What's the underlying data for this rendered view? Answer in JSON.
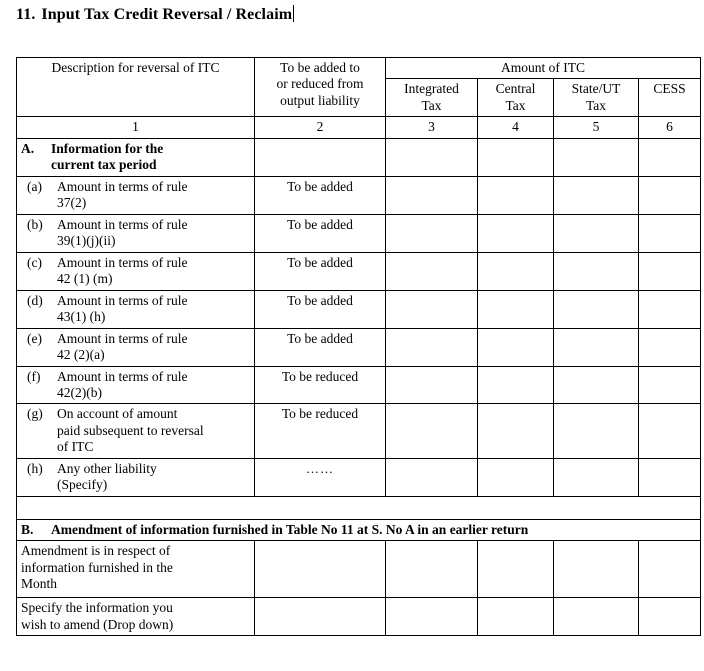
{
  "document": {
    "title_number": "11.",
    "title_text": "Input Tax Credit Reversal / Reclaim",
    "caret_visible": true
  },
  "table": {
    "headers": {
      "description": "Description for reversal of ITC",
      "liability_line1": "To be added to",
      "liability_line2": "or reduced from",
      "liability_line3": "output liability",
      "amount_group": "Amount of ITC",
      "integrated_line1": "Integrated",
      "integrated_line2": "Tax",
      "central_line1": "Central",
      "central_line2": "Tax",
      "state_line1": "State/UT",
      "state_line2": "Tax",
      "cess": "CESS"
    },
    "column_numbers": [
      "1",
      "2",
      "3",
      "4",
      "5",
      "6"
    ],
    "section_a": {
      "label": "A.",
      "title_line1": "Information for the",
      "title_line2": "current tax period",
      "rows": [
        {
          "mark": "(a)",
          "desc_line1": "Amount in terms of rule",
          "desc_line2": "37(2)",
          "liability": "To be added",
          "integrated": "",
          "central": "",
          "state": "",
          "cess": ""
        },
        {
          "mark": "(b)",
          "desc_line1": "Amount in terms of rule",
          "desc_line2": "39(1)(j)(ii)",
          "liability": "To be added",
          "integrated": "",
          "central": "",
          "state": "",
          "cess": ""
        },
        {
          "mark": "(c)",
          "desc_line1": "Amount in terms of rule",
          "desc_line2": "42 (1) (m)",
          "liability": "To be added",
          "integrated": "",
          "central": "",
          "state": "",
          "cess": ""
        },
        {
          "mark": "(d)",
          "desc_line1": "Amount in terms of rule",
          "desc_line2": "43(1) (h)",
          "liability": "To be added",
          "integrated": "",
          "central": "",
          "state": "",
          "cess": ""
        },
        {
          "mark": "(e)",
          "desc_line1": "Amount in terms of rule",
          "desc_line2": "42 (2)(a)",
          "liability": "To be added",
          "integrated": "",
          "central": "",
          "state": "",
          "cess": ""
        },
        {
          "mark": "(f)",
          "desc_line1": "Amount in terms of rule",
          "desc_line2": "42(2)(b)",
          "liability": "To be reduced",
          "integrated": "",
          "central": "",
          "state": "",
          "cess": ""
        },
        {
          "mark": "(g)",
          "desc_line1": "On account of amount",
          "desc_line2": "paid subsequent to reversal",
          "desc_line3": "of ITC",
          "liability": "To be reduced",
          "integrated": "",
          "central": "",
          "state": "",
          "cess": ""
        },
        {
          "mark": "(h)",
          "desc_line1": "Any other liability",
          "desc_line2": "(Specify)",
          "liability": "……",
          "integrated": "",
          "central": "",
          "state": "",
          "cess": ""
        }
      ]
    },
    "section_b": {
      "label": "B.",
      "title": "Amendment of information furnished in Table No 11 at S. No A in an earlier return",
      "rows": [
        {
          "desc_line1": "Amendment is in respect of",
          "desc_line2": "information furnished in the",
          "desc_line3": "Month",
          "liability_type": "month-boxes",
          "month_box_count": 8,
          "integrated": "",
          "central": "",
          "state": "",
          "cess": ""
        },
        {
          "desc_line1": "Specify the information you",
          "desc_line2": "wish to amend (Drop down)",
          "liability_type": "empty",
          "liability": "",
          "integrated": "",
          "central": "",
          "state": "",
          "cess": ""
        }
      ]
    }
  }
}
